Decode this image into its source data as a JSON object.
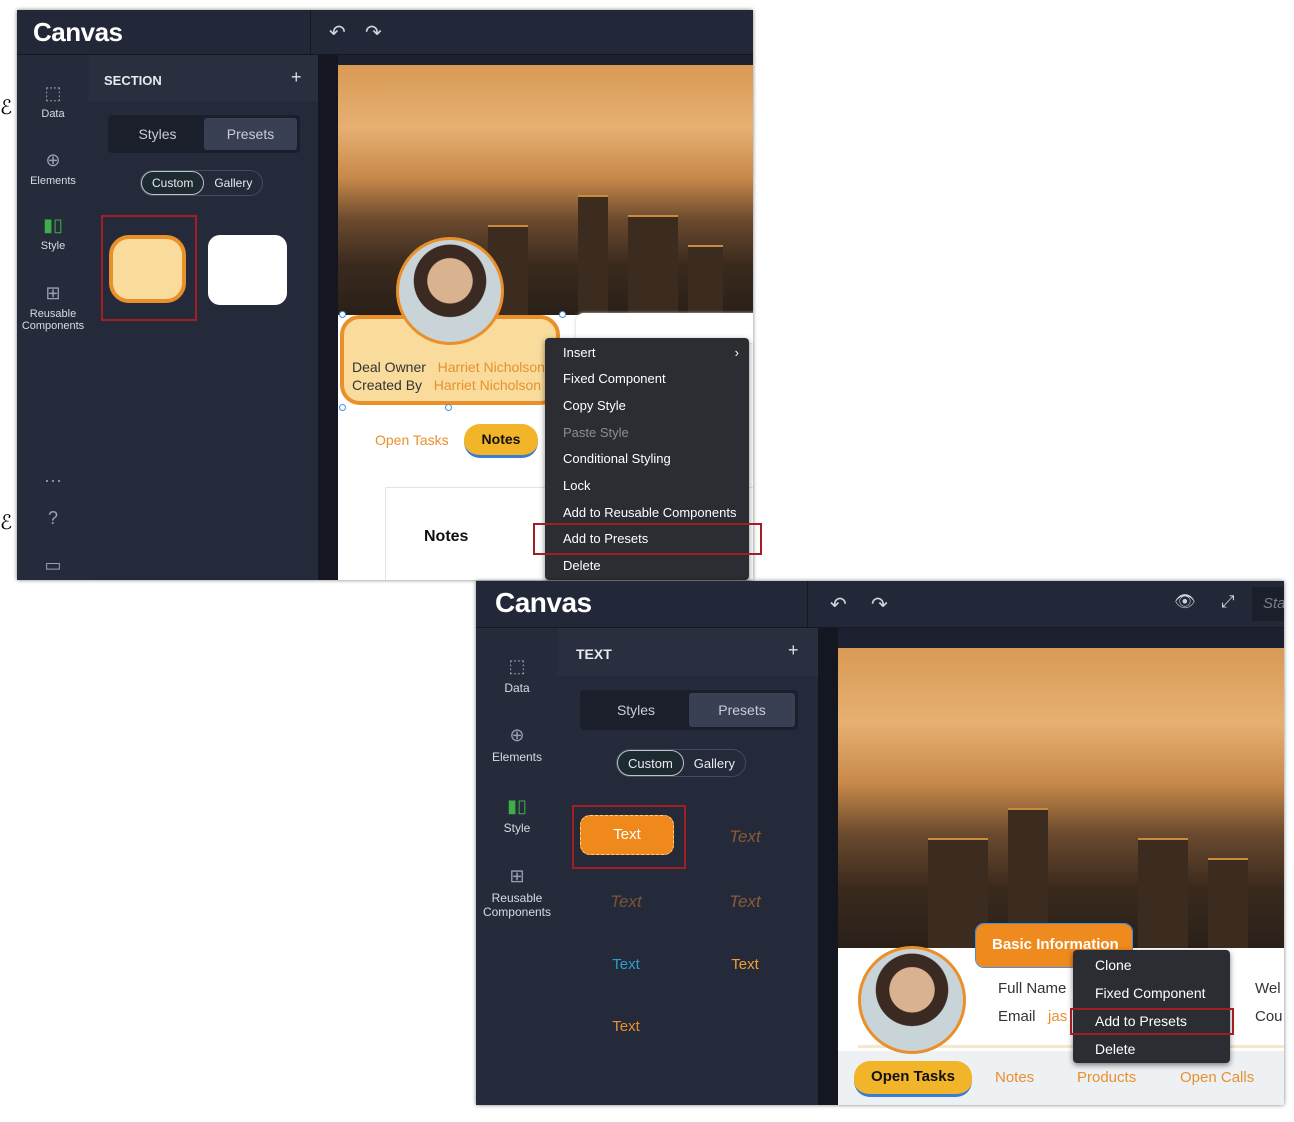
{
  "app": {
    "logo": "Canvas"
  },
  "rail": [
    {
      "label": "Data",
      "icon": "data-icon"
    },
    {
      "label": "Elements",
      "icon": "plus-circle-icon"
    },
    {
      "label": "Style",
      "icon": "style-icon"
    },
    {
      "label": "Reusable Components",
      "icon": "components-icon"
    }
  ],
  "screen1": {
    "panel_title": "SECTION",
    "seg": [
      "Styles",
      "Presets"
    ],
    "pill": [
      "Custom",
      "Gallery"
    ],
    "card": {
      "deal_owner_label": "Deal Owner",
      "deal_owner": "Harriet Nicholson",
      "created_by_label": "Created By",
      "created_by": "Harriet Nicholson"
    },
    "tabs": [
      "Open Tasks",
      "Notes"
    ],
    "notes_title": "Notes",
    "menu": [
      "Insert",
      "Fixed Component",
      "Copy Style",
      "Paste Style",
      "Conditional Styling",
      "Lock",
      "Add to Reusable Components",
      "Add to Presets",
      "Delete"
    ],
    "highlighted": "Add to Presets"
  },
  "screen2": {
    "panel_title": "TEXT",
    "seg": [
      "Styles",
      "Presets"
    ],
    "pill": [
      "Custom",
      "Gallery"
    ],
    "presets": [
      "Text",
      "Text",
      "Text",
      "Text",
      "Text",
      "Text",
      "Text"
    ],
    "status_partial": "Sta",
    "section_label": "Basic Information",
    "fields": {
      "full_name": "Full Name",
      "email": "Email",
      "email_value": "jas",
      "web": "Wel",
      "country": "Cou"
    },
    "tabs": [
      "Open Tasks",
      "Notes",
      "Products",
      "Open Calls"
    ],
    "menu": [
      "Clone",
      "Fixed Component",
      "Add to Presets",
      "Delete"
    ],
    "highlighted": "Add to Presets"
  },
  "colors": {
    "accent": "#e8902e",
    "highlight": "#a01e24",
    "active_icon": "#3fae4a"
  }
}
